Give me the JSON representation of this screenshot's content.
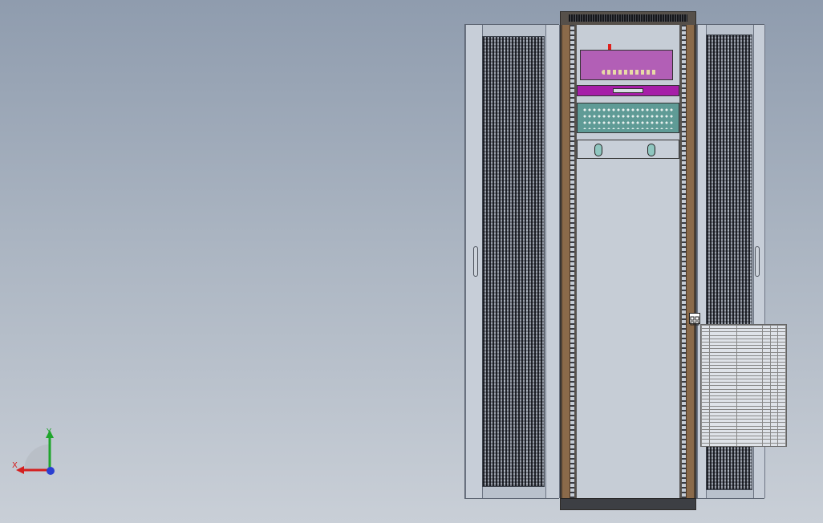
{
  "viewport": {
    "background_top": "#8f9cae",
    "background_bottom": "#c9cfd7"
  },
  "model": {
    "rack_frame_color": "#56504a",
    "post_color": "#8a6a4a",
    "door_color": "#b9c1cc",
    "components": [
      {
        "name": "pdu",
        "color": "#b25fb6"
      },
      {
        "name": "cable-tray",
        "color": "#a61ea8"
      },
      {
        "name": "patch-panel",
        "color": "#5f9b96"
      },
      {
        "name": "fan-shelf",
        "color": "#c8cfd8"
      }
    ]
  },
  "triad": {
    "x_label": "X",
    "y_label": "Y",
    "x_color": "#d42020",
    "y_color": "#1fa52c",
    "z_color": "#2a3fd1"
  },
  "bom_table": {
    "rows": 45,
    "cols": 6
  }
}
